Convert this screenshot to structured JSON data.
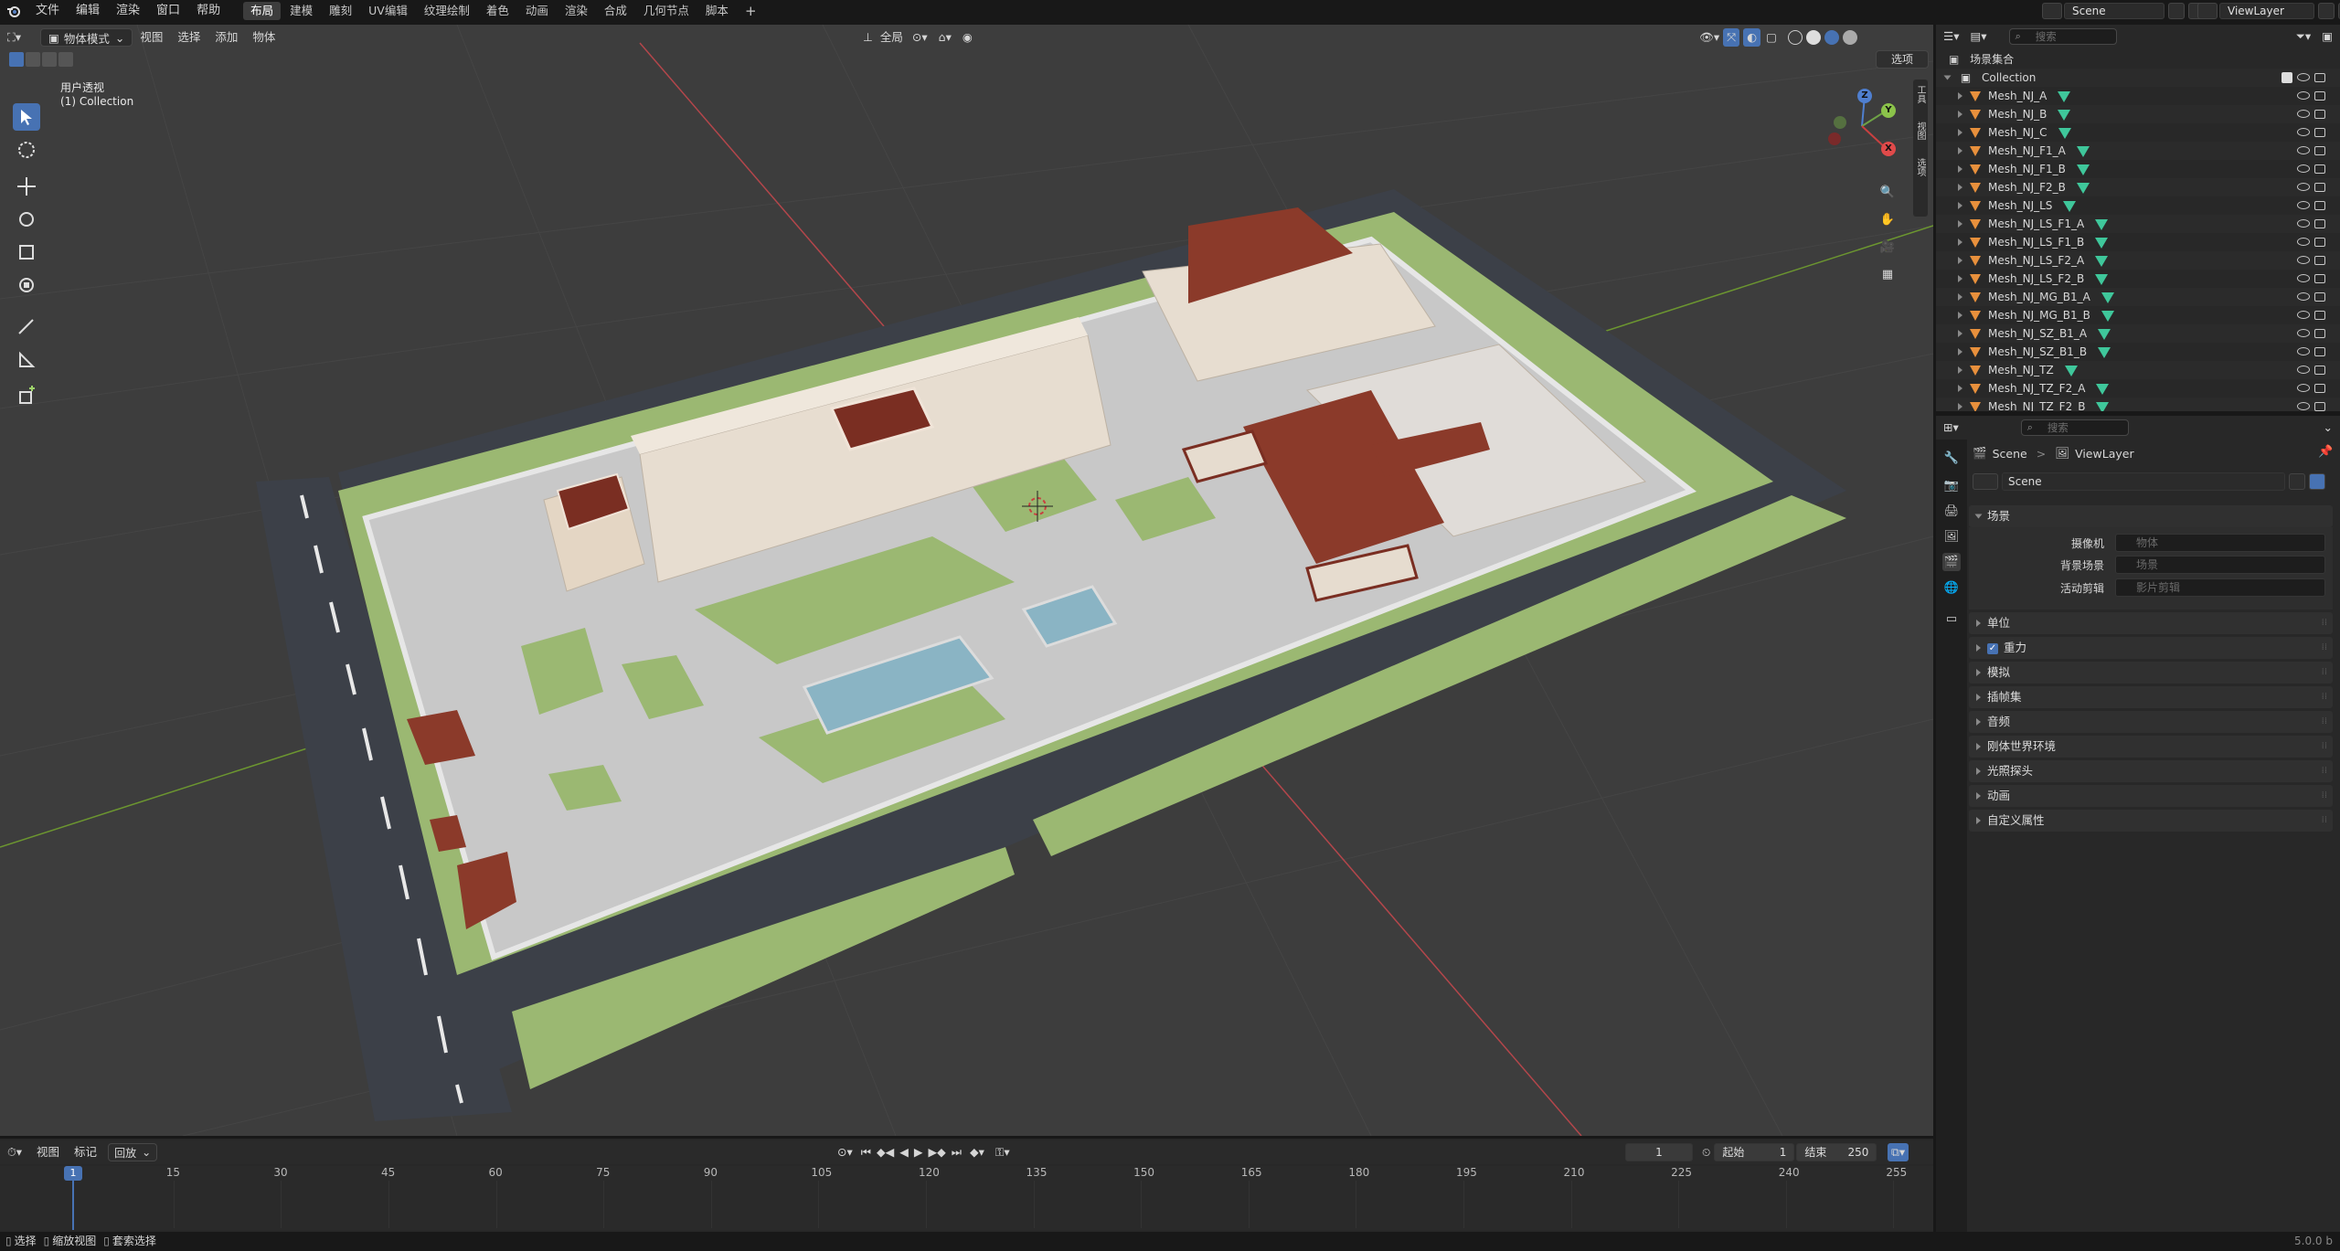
{
  "topbar": {
    "menus": [
      "文件",
      "编辑",
      "渲染",
      "窗口",
      "帮助"
    ],
    "workspaces": [
      "布局",
      "建模",
      "雕刻",
      "UV编辑",
      "纹理绘制",
      "着色",
      "动画",
      "渲染",
      "合成",
      "几何节点",
      "脚本"
    ],
    "active_workspace": "布局",
    "add_tab": "+",
    "scene_name": "Scene",
    "view_layer": "ViewLayer"
  },
  "viewport": {
    "mode": "物体模式",
    "menus": [
      "视图",
      "选择",
      "添加",
      "物体"
    ],
    "orientation": "全局",
    "options_label": "选项",
    "view_name": "用户透视",
    "collection_label": "(1) Collection",
    "side_tabs": [
      "工具",
      "视图",
      "选项"
    ],
    "gizmo": {
      "x": "X",
      "y": "Y",
      "z": "Z"
    }
  },
  "outliner": {
    "search_placeholder": "搜索",
    "root": "场景集合",
    "collection": "Collection",
    "items": [
      "Mesh_NJ_A",
      "Mesh_NJ_B",
      "Mesh_NJ_C",
      "Mesh_NJ_F1_A",
      "Mesh_NJ_F1_B",
      "Mesh_NJ_F2_B",
      "Mesh_NJ_LS",
      "Mesh_NJ_LS_F1_A",
      "Mesh_NJ_LS_F1_B",
      "Mesh_NJ_LS_F2_A",
      "Mesh_NJ_LS_F2_B",
      "Mesh_NJ_MG_B1_A",
      "Mesh_NJ_MG_B1_B",
      "Mesh_NJ_SZ_B1_A",
      "Mesh_NJ_SZ_B1_B",
      "Mesh_NJ_TZ",
      "Mesh_NJ_TZ_F2_A",
      "Mesh_NJ_TZ_F2_B"
    ]
  },
  "properties": {
    "search_placeholder": "搜索",
    "breadcrumb_scene": "Scene",
    "breadcrumb_sep": ">",
    "breadcrumb_layer": "ViewLayer",
    "scene_field": "Scene",
    "section_scene": "场景",
    "camera_label": "摄像机",
    "camera_placeholder": "物体",
    "background_label": "背景场景",
    "background_placeholder": "场景",
    "clip_label": "活动剪辑",
    "clip_placeholder": "影片剪辑",
    "panels": [
      "单位",
      "重力",
      "模拟",
      "插帧集",
      "音频",
      "刚体世界环境",
      "光照探头",
      "动画",
      "自定义属性"
    ],
    "gravity_checked": true
  },
  "timeline": {
    "menus": [
      "视图",
      "标记",
      "回放"
    ],
    "current_frame": "1",
    "start_label": "起始",
    "start_value": "1",
    "end_label": "结束",
    "end_value": "250",
    "ruler_ticks": [
      "1",
      "15",
      "30",
      "45",
      "60",
      "75",
      "90",
      "105",
      "120",
      "135",
      "150",
      "165",
      "180",
      "195",
      "210",
      "225",
      "240",
      "255"
    ]
  },
  "statusbar": {
    "items": [
      "选择",
      "缩放视图",
      "套索选择"
    ],
    "version": "5.0.0 b"
  },
  "colors": {
    "accent": "#4772b3",
    "viewport_bg": "#3d3d3d",
    "grass": "#9bb872",
    "roof": "#8b3a2a",
    "mesh_icon": "#e8903c",
    "data_icon": "#3fc79b"
  }
}
